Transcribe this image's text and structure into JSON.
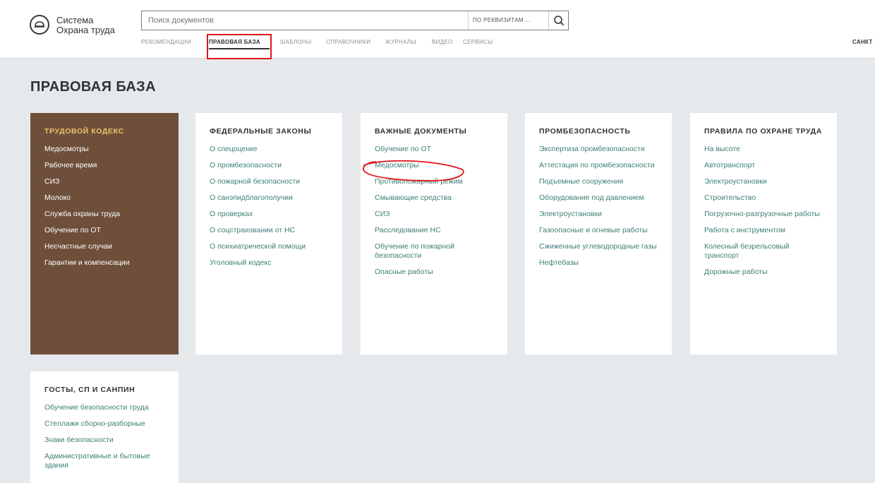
{
  "logo": {
    "line1": "Система",
    "line2": "Охрана труда"
  },
  "search": {
    "placeholder": "Поиск документов",
    "mode_label": "ПО РЕКВИЗИТАМ ..."
  },
  "nav": {
    "items": [
      {
        "label": "РЕКОМЕНДАЦИИ"
      },
      {
        "label": "ПРАВОВАЯ БАЗА",
        "active": true
      },
      {
        "label": "ШАБЛОНЫ"
      },
      {
        "label": "СПРАВОЧНИКИ"
      },
      {
        "label": "ЖУРНАЛЫ"
      },
      {
        "label": "ВИДЕО"
      },
      {
        "label": "СЕРВИСЫ"
      }
    ],
    "right_text": "САНКТ"
  },
  "page": {
    "title": "ПРАВОВАЯ БАЗА"
  },
  "cards": [
    {
      "title": "ТРУДОВОЙ КОДЕКС",
      "items": [
        "Медосмотры",
        "Рабочее время",
        "СИЗ",
        "Молоко",
        "Служба охраны труда",
        "Обучение по ОТ",
        "Несчастные случаи",
        "Гарантии и компенсации"
      ]
    },
    {
      "title": "ФЕДЕРАЛЬНЫЕ ЗАКОНЫ",
      "items": [
        "О спецоценке",
        "О промбезопасности",
        "О пожарной безопасности",
        "О санэпидблагополучии",
        "О проверках",
        "О соцстраховании от НС",
        "О психиатрической помощи",
        "Уголовный кодекс"
      ]
    },
    {
      "title": "ВАЖНЫЕ ДОКУМЕНТЫ",
      "items": [
        "Обучение по ОТ",
        "Медосмотры",
        "Противопожарный режим",
        "Смывающие средства",
        "СИЗ",
        "Расследование НС",
        "Обучение по пожарной безопасности",
        "Опасные работы"
      ]
    },
    {
      "title": "ПРОМБЕЗОПАСНОСТЬ",
      "items": [
        "Экспертиза промбезопасности",
        "Аттестация по промбезопасности",
        "Подъемные сооружения",
        "Оборудование под давлением",
        "Электроустановки",
        "Газоопасные и огневые работы",
        "Сжиженные углеводородные газы",
        "Нефтебазы"
      ]
    },
    {
      "title": "ПРАВИЛА ПО ОХРАНЕ ТРУДА",
      "items": [
        "На высоте",
        "Автотранспорт",
        "Электроустановки",
        "Строительство",
        "Погрузочно-разгрузочные работы",
        "Работа с инструментом",
        "Колесный безрельсовый транспорт",
        "Дорожные работы"
      ]
    },
    {
      "title": "ГОСТЫ, СП И САНПИН",
      "items": [
        "Обучение безопасности труда",
        "Стеллажи сборно-разборные",
        "Знаки безопасности",
        "Административные и бытовые здания"
      ]
    }
  ],
  "colors": {
    "accent_link": "#3b7f76",
    "brown_card": "#6e503a",
    "brown_title": "#ecc06a",
    "highlight_red": "#e0141a",
    "page_bg": "#e6e9ec"
  }
}
